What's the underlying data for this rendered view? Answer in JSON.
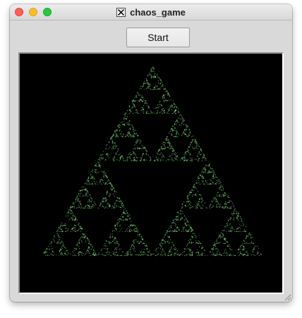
{
  "window": {
    "title": "chaos_game",
    "title_icon": "x11-icon",
    "traffic_lights": {
      "close": "#fe5f57",
      "minimize": "#febc2e",
      "zoom": "#28c840"
    }
  },
  "toolbar": {
    "start_label": "Start"
  },
  "canvas": {
    "background": "#000000",
    "point_color": "#7fd17f",
    "fractal": "sierpinski-triangle"
  },
  "icons": {
    "resize": "resize-grip-icon"
  }
}
